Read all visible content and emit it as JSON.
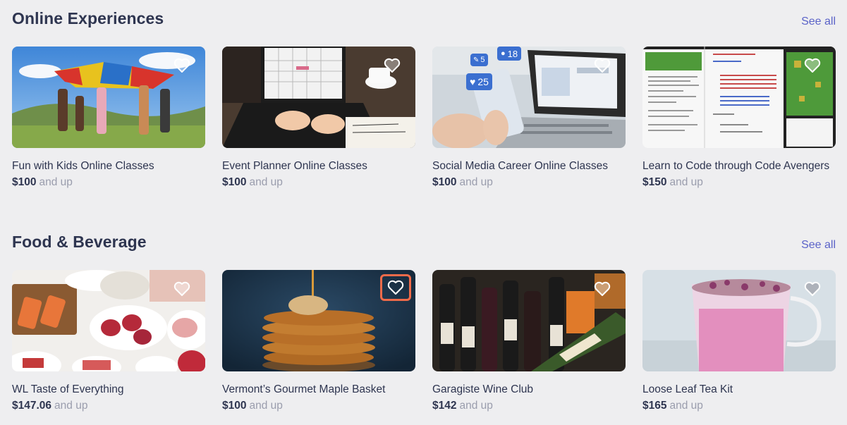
{
  "sections": [
    {
      "title": "Online Experiences",
      "see_all": "See all",
      "cards": [
        {
          "title": "Fun with Kids Online Classes",
          "price": "$100",
          "suffix": "and up",
          "icon": "heart-outline-icon"
        },
        {
          "title": "Event Planner Online Classes",
          "price": "$100",
          "suffix": "and up",
          "icon": "heart-outline-icon"
        },
        {
          "title": "Social Media Career Online Classes",
          "price": "$100",
          "suffix": "and up",
          "icon": "heart-outline-icon",
          "badges": {
            "comments": "5",
            "followers": "18",
            "likes": "25"
          }
        },
        {
          "title": "Learn to Code through Code Avengers",
          "price": "$150",
          "suffix": "and up",
          "icon": "heart-outline-icon"
        }
      ]
    },
    {
      "title": "Food & Beverage",
      "see_all": "See all",
      "cards": [
        {
          "title": "WL Taste of Everything",
          "price": "$147.06",
          "suffix": "and up",
          "icon": "heart-outline-icon"
        },
        {
          "title": "Vermont’s Gourmet Maple Basket",
          "price": "$100",
          "suffix": "and up",
          "icon": "heart-outline-icon",
          "focused": true
        },
        {
          "title": "Garagiste Wine Club",
          "price": "$142",
          "suffix": "and up",
          "icon": "heart-outline-icon"
        },
        {
          "title": "Loose Leaf Tea Kit",
          "price": "$165",
          "suffix": "and up",
          "icon": "heart-outline-icon"
        }
      ]
    }
  ],
  "colors": {
    "background": "#eeeef0",
    "heading": "#2e3550",
    "link": "#5b63c8",
    "muted": "#9a9dad",
    "focus_ring": "#ef6b4a"
  }
}
